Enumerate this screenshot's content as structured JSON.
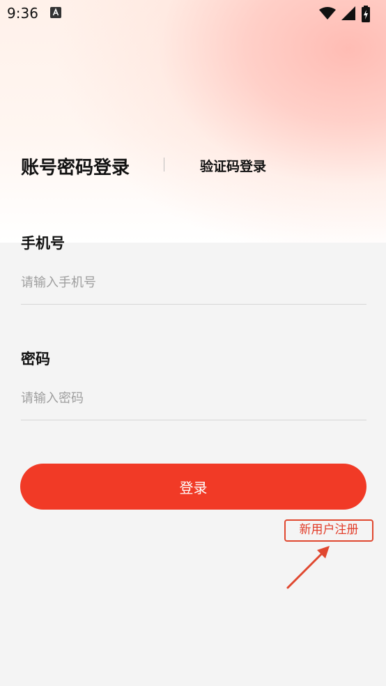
{
  "status_bar": {
    "time": "9:36",
    "icons": [
      "a-notification-icon",
      "wifi-icon",
      "signal-icon",
      "battery-charging-icon"
    ]
  },
  "tabs": {
    "active_label": "账号密码登录",
    "inactive_label": "验证码登录"
  },
  "form": {
    "phone": {
      "label": "手机号",
      "placeholder": "请输入手机号",
      "value": ""
    },
    "password": {
      "label": "密码",
      "placeholder": "请输入密码",
      "value": ""
    }
  },
  "login_button": {
    "label": "登录"
  },
  "register_link": {
    "label": "新用户注册"
  },
  "colors": {
    "accent": "#f13a26",
    "annotation": "#e0472f",
    "background": "#f4f4f4",
    "hero_gradient": "#ffbcb4"
  }
}
